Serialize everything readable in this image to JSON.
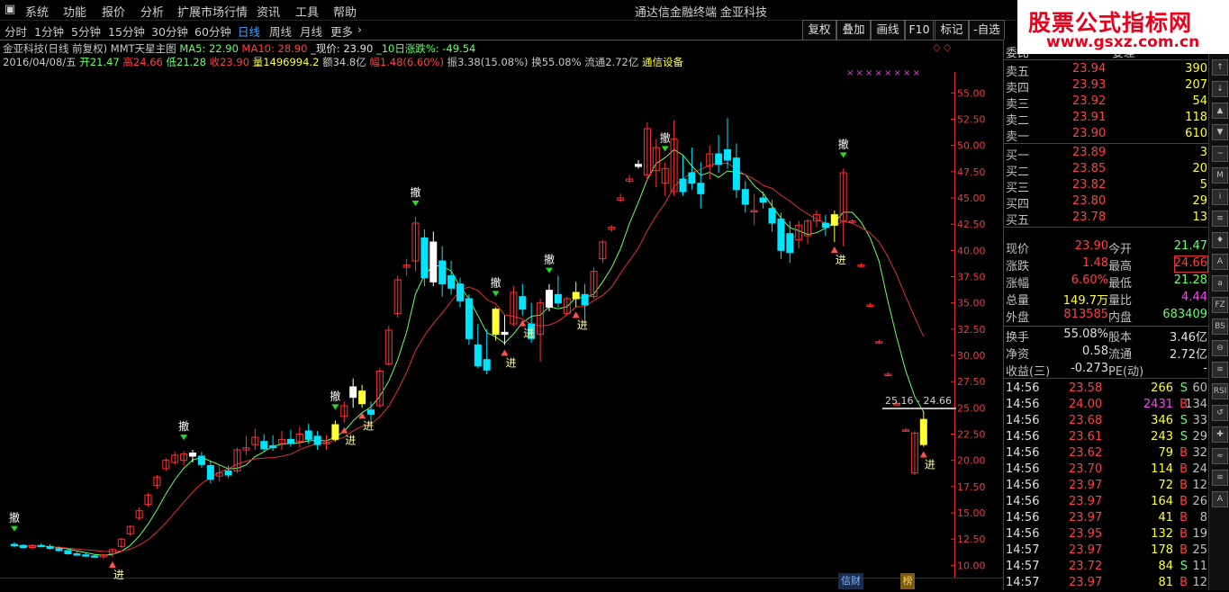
{
  "menu": [
    "系统",
    "功能",
    "报价",
    "分析",
    "扩展市场行情",
    "资讯",
    "工具",
    "帮助"
  ],
  "window_title": "通达信金融终端",
  "stock_title": "金亚科技",
  "period_tabs": [
    "分时",
    "1分钟",
    "5分钟",
    "15分钟",
    "30分钟",
    "60分钟",
    "日线",
    "周线",
    "月线",
    "更多",
    "›"
  ],
  "active_period": "日线",
  "toolbar_buttons": [
    "复权",
    "叠加",
    "画线",
    "F10",
    "标记",
    "-自选"
  ],
  "banner": {
    "title": "股票公式指标网",
    "url": "www.gsxz.com.cn"
  },
  "info_line1": {
    "name": "金亚科技(日线 前复权)",
    "indicator": "MMT天星主图",
    "ma5": "MA5: 22.90",
    "ma10": "MA10: 28.90",
    "price": "_现价: 23.90",
    "chg10": "_10日涨跌%: -49.54"
  },
  "info_line2": {
    "date": "2016/04/08/五",
    "open_label": "开",
    "open": "21.47",
    "high_label": "高",
    "high": "24.66",
    "low_label": "低",
    "low": "21.28",
    "close_label": "收",
    "close": "23.90",
    "vol_label": "量",
    "vol": "1496994.2",
    "amt_label": "额",
    "amt": "34.8亿",
    "amp_label": "幅",
    "amp": "1.48(6.60%)",
    "osc": "振3.38(15.08%)",
    "turn": "换55.08%",
    "float": "流通2.72亿",
    "industry": "通信设备"
  },
  "y_axis_ticks": [
    "55.00",
    "52.50",
    "50.00",
    "47.50",
    "45.00",
    "42.50",
    "40.00",
    "37.50",
    "35.00",
    "32.50",
    "30.00",
    "27.50",
    "25.00",
    "22.50",
    "20.00",
    "17.50",
    "15.00",
    "12.50",
    "10.00"
  ],
  "range_label": "25.16 - 24.66",
  "chart_data": {
    "type": "candlestick",
    "ylim": [
      9,
      57
    ],
    "candles": [
      {
        "o": 12.0,
        "h": 12.2,
        "l": 11.7,
        "c": 11.9
      },
      {
        "o": 11.9,
        "h": 12.0,
        "l": 11.6,
        "c": 11.7
      },
      {
        "o": 11.7,
        "h": 12.0,
        "l": 11.5,
        "c": 11.9
      },
      {
        "o": 11.9,
        "h": 12.1,
        "l": 11.7,
        "c": 11.8
      },
      {
        "o": 11.8,
        "h": 12.0,
        "l": 11.5,
        "c": 11.6
      },
      {
        "o": 11.6,
        "h": 11.8,
        "l": 11.3,
        "c": 11.4
      },
      {
        "o": 11.4,
        "h": 11.5,
        "l": 11.0,
        "c": 11.1
      },
      {
        "o": 11.1,
        "h": 11.3,
        "l": 10.9,
        "c": 11.0
      },
      {
        "o": 11.0,
        "h": 11.2,
        "l": 10.8,
        "c": 10.9
      },
      {
        "o": 10.9,
        "h": 11.0,
        "l": 10.7,
        "c": 10.8
      },
      {
        "o": 10.8,
        "h": 11.1,
        "l": 10.6,
        "c": 11.0
      },
      {
        "o": 11.1,
        "h": 11.6,
        "l": 10.8,
        "c": 11.5
      },
      {
        "o": 11.8,
        "h": 12.6,
        "l": 11.6,
        "c": 12.5
      },
      {
        "o": 13.0,
        "h": 13.8,
        "l": 12.8,
        "c": 13.7
      },
      {
        "o": 14.5,
        "h": 15.5,
        "l": 14.3,
        "c": 15.2
      },
      {
        "o": 15.8,
        "h": 16.9,
        "l": 15.6,
        "c": 16.7
      },
      {
        "o": 17.6,
        "h": 18.6,
        "l": 17.3,
        "c": 18.4
      },
      {
        "o": 19.2,
        "h": 20.2,
        "l": 19.0,
        "c": 20.0
      },
      {
        "o": 19.8,
        "h": 20.8,
        "l": 19.6,
        "c": 20.5
      },
      {
        "o": 20.0,
        "h": 20.9,
        "l": 19.5,
        "c": 20.6
      },
      {
        "o": 20.4,
        "h": 21.0,
        "l": 19.8,
        "c": 20.7
      },
      {
        "o": 20.4,
        "h": 20.8,
        "l": 19.3,
        "c": 19.6
      },
      {
        "o": 19.5,
        "h": 19.9,
        "l": 17.8,
        "c": 18.2
      },
      {
        "o": 18.5,
        "h": 19.6,
        "l": 18.0,
        "c": 18.8
      },
      {
        "o": 19.0,
        "h": 19.5,
        "l": 18.3,
        "c": 18.6
      },
      {
        "o": 19.0,
        "h": 21.2,
        "l": 18.8,
        "c": 21.0
      },
      {
        "o": 21.0,
        "h": 22.3,
        "l": 20.5,
        "c": 21.2
      },
      {
        "o": 21.5,
        "h": 23.0,
        "l": 21.0,
        "c": 22.2
      },
      {
        "o": 21.8,
        "h": 22.5,
        "l": 20.8,
        "c": 21.1
      },
      {
        "o": 21.4,
        "h": 22.4,
        "l": 20.9,
        "c": 21.2
      },
      {
        "o": 21.6,
        "h": 22.8,
        "l": 21.0,
        "c": 22.0
      },
      {
        "o": 22.0,
        "h": 22.9,
        "l": 21.3,
        "c": 21.6
      },
      {
        "o": 21.8,
        "h": 23.2,
        "l": 21.2,
        "c": 22.5
      },
      {
        "o": 22.8,
        "h": 23.5,
        "l": 21.6,
        "c": 22.0
      },
      {
        "o": 22.3,
        "h": 22.8,
        "l": 21.0,
        "c": 21.5
      },
      {
        "o": 21.6,
        "h": 22.4,
        "l": 21.0,
        "c": 21.7
      },
      {
        "o": 22.0,
        "h": 23.8,
        "l": 21.8,
        "c": 23.4
      },
      {
        "o": 24.2,
        "h": 25.6,
        "l": 23.6,
        "c": 25.2
      },
      {
        "o": 26.0,
        "h": 27.8,
        "l": 25.0,
        "c": 27.0
      },
      {
        "o": 26.6,
        "h": 27.2,
        "l": 25.0,
        "c": 25.4
      },
      {
        "o": 24.8,
        "h": 25.6,
        "l": 23.8,
        "c": 24.4
      },
      {
        "o": 25.2,
        "h": 28.8,
        "l": 25.0,
        "c": 28.5
      },
      {
        "o": 29.2,
        "h": 32.8,
        "l": 29.0,
        "c": 32.4
      },
      {
        "o": 34.0,
        "h": 37.6,
        "l": 33.6,
        "c": 37.2
      },
      {
        "o": 38.4,
        "h": 39.2,
        "l": 37.6,
        "c": 38.6
      },
      {
        "o": 39.0,
        "h": 43.2,
        "l": 38.0,
        "c": 42.6
      },
      {
        "o": 41.2,
        "h": 42.0,
        "l": 36.6,
        "c": 37.4
      },
      {
        "o": 40.8,
        "h": 41.8,
        "l": 36.6,
        "c": 37.0
      },
      {
        "o": 39.0,
        "h": 40.4,
        "l": 35.6,
        "c": 36.8
      },
      {
        "o": 37.6,
        "h": 39.0,
        "l": 35.8,
        "c": 36.4
      },
      {
        "o": 36.8,
        "h": 37.4,
        "l": 34.6,
        "c": 35.2
      },
      {
        "o": 35.4,
        "h": 35.8,
        "l": 31.0,
        "c": 31.6
      },
      {
        "o": 31.0,
        "h": 33.0,
        "l": 28.8,
        "c": 29.0
      },
      {
        "o": 29.6,
        "h": 32.5,
        "l": 28.2,
        "c": 28.6
      },
      {
        "o": 32.0,
        "h": 34.6,
        "l": 31.4,
        "c": 34.4
      },
      {
        "o": 32.0,
        "h": 33.8,
        "l": 31.0,
        "c": 32.2
      },
      {
        "o": 33.0,
        "h": 36.6,
        "l": 32.8,
        "c": 36.0
      },
      {
        "o": 35.6,
        "h": 36.8,
        "l": 33.8,
        "c": 34.4
      },
      {
        "o": 33.0,
        "h": 35.0,
        "l": 31.2,
        "c": 31.6
      },
      {
        "o": 32.0,
        "h": 35.4,
        "l": 29.4,
        "c": 35.0
      },
      {
        "o": 34.6,
        "h": 36.8,
        "l": 34.2,
        "c": 36.2
      },
      {
        "o": 35.8,
        "h": 37.6,
        "l": 34.6,
        "c": 35.0
      },
      {
        "o": 34.0,
        "h": 35.6,
        "l": 33.8,
        "c": 35.4
      },
      {
        "o": 35.4,
        "h": 37.0,
        "l": 34.6,
        "c": 36.0
      },
      {
        "o": 35.8,
        "h": 36.8,
        "l": 33.4,
        "c": 34.8
      },
      {
        "o": 35.6,
        "h": 38.4,
        "l": 35.4,
        "c": 38.0
      },
      {
        "o": 39.2,
        "h": 41.0,
        "l": 38.8,
        "c": 40.8
      },
      {
        "o": 42.0,
        "h": 42.4,
        "l": 41.8,
        "c": 42.2
      },
      {
        "o": 44.8,
        "h": 45.4,
        "l": 44.6,
        "c": 45.0
      },
      {
        "o": 46.6,
        "h": 47.2,
        "l": 46.4,
        "c": 46.8
      },
      {
        "o": 48.0,
        "h": 48.6,
        "l": 47.8,
        "c": 48.2
      },
      {
        "o": 47.2,
        "h": 52.2,
        "l": 46.6,
        "c": 51.6
      },
      {
        "o": 47.6,
        "h": 50.6,
        "l": 46.0,
        "c": 49.8
      },
      {
        "o": 46.4,
        "h": 48.4,
        "l": 45.2,
        "c": 47.8
      },
      {
        "o": 45.6,
        "h": 52.4,
        "l": 45.2,
        "c": 50.6
      },
      {
        "o": 46.8,
        "h": 49.0,
        "l": 45.2,
        "c": 45.6
      },
      {
        "o": 47.4,
        "h": 49.8,
        "l": 45.8,
        "c": 46.4
      },
      {
        "o": 46.4,
        "h": 48.4,
        "l": 44.0,
        "c": 45.4
      },
      {
        "o": 48.0,
        "h": 50.0,
        "l": 46.8,
        "c": 49.2
      },
      {
        "o": 49.2,
        "h": 51.0,
        "l": 47.4,
        "c": 48.2
      },
      {
        "o": 49.6,
        "h": 52.6,
        "l": 47.8,
        "c": 48.6
      },
      {
        "o": 48.8,
        "h": 50.2,
        "l": 45.0,
        "c": 45.8
      },
      {
        "o": 45.8,
        "h": 46.6,
        "l": 43.6,
        "c": 44.4
      },
      {
        "o": 43.8,
        "h": 45.4,
        "l": 42.4,
        "c": 43.8
      },
      {
        "o": 45.0,
        "h": 45.6,
        "l": 44.0,
        "c": 44.6
      },
      {
        "o": 44.0,
        "h": 44.8,
        "l": 41.8,
        "c": 42.6
      },
      {
        "o": 43.0,
        "h": 43.6,
        "l": 39.2,
        "c": 40.0
      },
      {
        "o": 41.6,
        "h": 42.8,
        "l": 38.8,
        "c": 39.8
      },
      {
        "o": 41.0,
        "h": 42.8,
        "l": 40.2,
        "c": 42.4
      },
      {
        "o": 41.4,
        "h": 43.0,
        "l": 40.6,
        "c": 42.8
      },
      {
        "o": 42.8,
        "h": 43.8,
        "l": 42.2,
        "c": 43.4
      },
      {
        "o": 42.6,
        "h": 43.4,
        "l": 41.4,
        "c": 42.2
      },
      {
        "o": 43.4,
        "h": 43.8,
        "l": 40.8,
        "c": 42.4
      },
      {
        "o": 42.8,
        "h": 47.8,
        "l": 40.4,
        "c": 47.4
      },
      {
        "o": 42.8,
        "h": 43.0,
        "l": 42.6,
        "c": 42.8
      },
      {
        "o": 38.6,
        "h": 38.8,
        "l": 38.4,
        "c": 38.6
      },
      {
        "o": 34.8,
        "h": 35.0,
        "l": 34.6,
        "c": 34.8
      },
      {
        "o": 31.3,
        "h": 31.5,
        "l": 31.1,
        "c": 31.3
      },
      {
        "o": 28.2,
        "h": 28.4,
        "l": 28.0,
        "c": 28.2
      },
      {
        "o": 25.4,
        "h": 25.6,
        "l": 25.2,
        "c": 25.4
      },
      {
        "o": 22.9,
        "h": 23.1,
        "l": 22.7,
        "c": 22.9
      },
      {
        "o": 18.8,
        "h": 22.8,
        "l": 18.6,
        "c": 22.6
      },
      {
        "o": 21.5,
        "h": 24.7,
        "l": 21.3,
        "c": 23.9
      }
    ],
    "ma_fast_label": "MA5",
    "ma_slow_label": "MA10",
    "signals": [
      {
        "i": 0,
        "type": "撤"
      },
      {
        "i": 11,
        "type": "进"
      },
      {
        "i": 19,
        "type": "撤"
      },
      {
        "i": 36,
        "type": "撤"
      },
      {
        "i": 37,
        "type": "进"
      },
      {
        "i": 39,
        "type": "进"
      },
      {
        "i": 45,
        "type": "撤"
      },
      {
        "i": 54,
        "type": "撤"
      },
      {
        "i": 55,
        "type": "进"
      },
      {
        "i": 57,
        "type": "进"
      },
      {
        "i": 60,
        "type": "撤"
      },
      {
        "i": 63,
        "type": "进"
      },
      {
        "i": 73,
        "type": "撤"
      },
      {
        "i": 93,
        "type": "撤"
      },
      {
        "i": 92,
        "type": "进"
      },
      {
        "i": 102,
        "type": "进"
      }
    ]
  },
  "quote": {
    "header": {
      "a": "委比",
      "b": "38.94%",
      "c": "委差",
      "d": "1509"
    },
    "asks": [
      {
        "label": "卖五",
        "price": "23.94",
        "vol": "390"
      },
      {
        "label": "卖四",
        "price": "23.93",
        "vol": "207"
      },
      {
        "label": "卖三",
        "price": "23.92",
        "vol": "54"
      },
      {
        "label": "卖二",
        "price": "23.91",
        "vol": "118"
      },
      {
        "label": "卖一",
        "price": "23.90",
        "vol": "610"
      }
    ],
    "bids": [
      {
        "label": "买一",
        "price": "23.89",
        "vol": "3"
      },
      {
        "label": "买二",
        "price": "23.85",
        "vol": "20"
      },
      {
        "label": "买三",
        "price": "23.82",
        "vol": "5"
      },
      {
        "label": "买四",
        "price": "23.80",
        "vol": "29"
      },
      {
        "label": "买五",
        "price": "23.78",
        "vol": "13"
      }
    ],
    "stats": [
      {
        "l1": "现价",
        "v1": "23.90",
        "l2": "今开",
        "v2": "21.47"
      },
      {
        "l1": "涨跌",
        "v1": "1.48",
        "l2": "最高",
        "v2": "24.66"
      },
      {
        "l1": "涨幅",
        "v1": "6.60%",
        "l2": "最低",
        "v2": "21.28"
      },
      {
        "l1": "总量",
        "v1": "149.7万",
        "l2": "量比",
        "v2": "4.44"
      },
      {
        "l1": "外盘",
        "v1": "813585",
        "l2": "内盘",
        "v2": "683409"
      }
    ],
    "fundamentals": [
      {
        "l1": "换手",
        "v1": "55.08%",
        "l2": "股本",
        "v2": "3.46亿"
      },
      {
        "l1": "净资",
        "v1": "0.58",
        "l2": "流通",
        "v2": "2.72亿"
      },
      {
        "l1": "收益(三)",
        "v1": "-0.273",
        "l2": "PE(动)",
        "v2": "-"
      }
    ],
    "ticks": [
      {
        "t": "14:56",
        "p": "23.58",
        "v": "266",
        "s": "S",
        "n": "60"
      },
      {
        "t": "14:56",
        "p": "24.00",
        "v": "2431",
        "s": "B",
        "n": "134"
      },
      {
        "t": "14:56",
        "p": "23.68",
        "v": "346",
        "s": "S",
        "n": "33"
      },
      {
        "t": "14:56",
        "p": "23.61",
        "v": "243",
        "s": "S",
        "n": "29"
      },
      {
        "t": "14:56",
        "p": "23.62",
        "v": "79",
        "s": "B",
        "n": "32"
      },
      {
        "t": "14:56",
        "p": "23.70",
        "v": "114",
        "s": "B",
        "n": "24"
      },
      {
        "t": "14:56",
        "p": "23.97",
        "v": "72",
        "s": "B",
        "n": "12"
      },
      {
        "t": "14:56",
        "p": "23.97",
        "v": "164",
        "s": "B",
        "n": "26"
      },
      {
        "t": "14:56",
        "p": "23.97",
        "v": "41",
        "s": "B",
        "n": "8"
      },
      {
        "t": "14:56",
        "p": "23.95",
        "v": "132",
        "s": "B",
        "n": "19"
      },
      {
        "t": "14:57",
        "p": "23.97",
        "v": "178",
        "s": "B",
        "n": "25"
      },
      {
        "t": "14:57",
        "p": "23.72",
        "v": "84",
        "s": "S",
        "n": "11"
      },
      {
        "t": "14:57",
        "p": "23.97",
        "v": "81",
        "s": "B",
        "n": "12"
      }
    ]
  },
  "bottom_tabs": [
    "信财",
    "榜"
  ],
  "side_icons": [
    "↑",
    "↓",
    "▲",
    "▼",
    "~",
    "M",
    "i",
    "≡",
    "♦",
    "A",
    "a",
    "FZ",
    "BS",
    "⊖",
    "≋",
    "RSI",
    "↺",
    "✚",
    "≈",
    "≋",
    "A"
  ],
  "colors": {
    "up": "#ff3232",
    "down": "#00e5ff",
    "ma_fast": "#66ff66",
    "ma_slow": "#e03030",
    "accent": "#3fa6ff",
    "yellow": "#ffff33"
  }
}
